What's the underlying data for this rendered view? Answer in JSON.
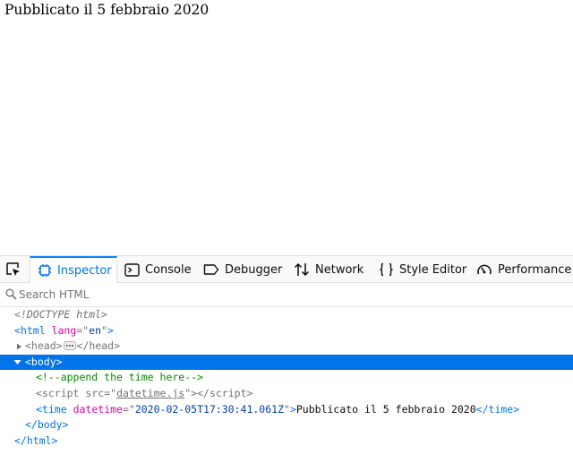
{
  "page": {
    "text": "Pubblicato il 5 febbraio 2020"
  },
  "devtools": {
    "tabs": [
      {
        "label": "Inspector",
        "icon": "inspector-icon",
        "selected": true
      },
      {
        "label": "Console",
        "icon": "console-icon",
        "selected": false
      },
      {
        "label": "Debugger",
        "icon": "debugger-icon",
        "selected": false
      },
      {
        "label": "Network",
        "icon": "network-icon",
        "selected": false
      },
      {
        "label": "Style Editor",
        "icon": "style-editor-icon",
        "selected": false
      },
      {
        "label": "Performance",
        "icon": "performance-icon",
        "selected": false
      }
    ],
    "search": {
      "placeholder": "Search HTML",
      "value": ""
    },
    "tree": {
      "doctype": "<!DOCTYPE html>",
      "html_open": {
        "tag": "html",
        "attr_name": "lang",
        "attr_value": "en"
      },
      "head": {
        "open": "<head>",
        "close": "</head>"
      },
      "body_open": "<body>",
      "comment": "<!--append the time here-->",
      "script": {
        "tag": "script",
        "attr_name": "src",
        "attr_value": "datetime.js"
      },
      "time": {
        "tag": "time",
        "attr_name": "datetime",
        "attr_value": "2020-02-05T17:30:41.061Z",
        "text": "Pubblicato il 5 febbraio 2020"
      },
      "body_close": "</body>",
      "html_close": "</html>"
    }
  },
  "colors": {
    "accent": "#0a84ff",
    "selection": "#0074e8",
    "tag": "#0074e8",
    "attr_name": "#dd00a9",
    "attr_value": "#003eaa",
    "comment": "#058b00"
  }
}
